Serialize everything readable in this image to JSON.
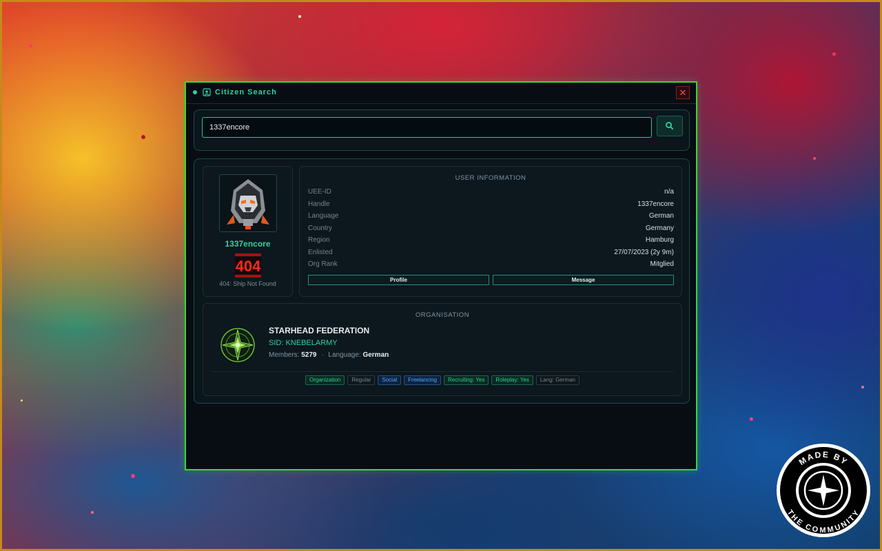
{
  "window": {
    "title": "Citizen Search",
    "close_label": "✕",
    "accent_color": "#3cd43a",
    "title_color": "#2ed3a0"
  },
  "search": {
    "value": "1337encore",
    "button_icon": "search-icon"
  },
  "avatar": {
    "handle": "1337encore",
    "error_code": "404",
    "error_caption": "404: Ship Not Found"
  },
  "user_info": {
    "heading": "USER INFORMATION",
    "rows": [
      {
        "key": "UEE-ID",
        "value": "n/a"
      },
      {
        "key": "Handle",
        "value": "1337encore"
      },
      {
        "key": "Language",
        "value": "German"
      },
      {
        "key": "Country",
        "value": "Germany"
      },
      {
        "key": "Region",
        "value": "Hamburg"
      },
      {
        "key": "Enlisted",
        "value": "27/07/2023 (2y 9m)"
      },
      {
        "key": "Org Rank",
        "value": "Mitglied"
      }
    ],
    "profile_label": "Profile",
    "message_label": "Message"
  },
  "organisation": {
    "heading": "ORGANISATION",
    "name": "STARHEAD FEDERATION",
    "sid": "SID: KNEBELARMY",
    "members_label": "Members:",
    "members_value": "5279",
    "separator": "·",
    "language_label": "Language:",
    "language_value": "German",
    "tags": [
      {
        "label": "Organization",
        "style": "green"
      },
      {
        "label": "Regular",
        "style": "gray"
      },
      {
        "label": "Social",
        "style": "blue"
      },
      {
        "label": "Freelancing",
        "style": "blue"
      },
      {
        "label": "Recruiting: Yes",
        "style": "green"
      },
      {
        "label": "Roleplay: Yes",
        "style": "green"
      },
      {
        "label": "Lang: German",
        "style": "gray"
      }
    ]
  },
  "community_badge": {
    "text_top": "MADE BY",
    "text_bottom": "THE COMMUNITY"
  }
}
